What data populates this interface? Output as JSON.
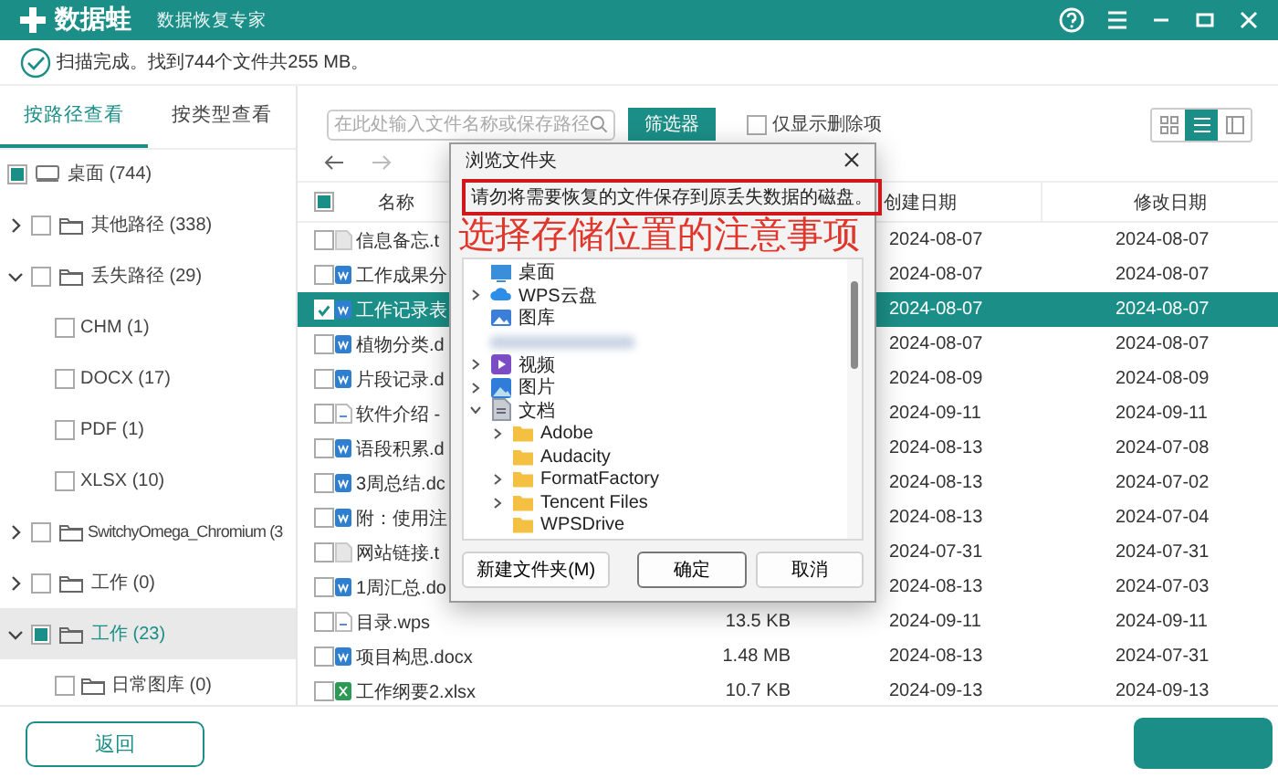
{
  "window": {
    "logo": "数据蛙",
    "subtitle": "数据恢复专家"
  },
  "status": {
    "text": "扫描完成。找到744个文件共255 MB。"
  },
  "sidebar": {
    "tabs": [
      {
        "label": "按路径查看",
        "selected": true
      },
      {
        "label": "按类型查看",
        "selected": false
      }
    ],
    "tree": [
      {
        "label": "桌面 (744)",
        "kind": "drive",
        "checked": false,
        "partial": true,
        "selected": false
      },
      {
        "label": "其他路径 (338)",
        "kind": "folder",
        "checked": false,
        "partial": false,
        "expanded": false,
        "selected": false
      },
      {
        "label": "丢失路径 (29)",
        "kind": "folder",
        "checked": false,
        "partial": false,
        "expanded": true,
        "selected": false,
        "children": [
          {
            "label": "CHM (1)",
            "kind": "type",
            "checked": false,
            "partial": false,
            "selected": false
          },
          {
            "label": "DOCX (17)",
            "kind": "type",
            "checked": false,
            "partial": false,
            "selected": false
          },
          {
            "label": "PDF (1)",
            "kind": "type",
            "checked": false,
            "partial": false,
            "selected": false
          },
          {
            "label": "XLSX (10)",
            "kind": "type",
            "checked": false,
            "partial": false,
            "selected": false
          }
        ]
      },
      {
        "label": "SwitchyOmega_Chromium (3",
        "kind": "folder",
        "checked": false,
        "partial": false,
        "expanded": false,
        "selected": false
      },
      {
        "label": "工作 (0)",
        "kind": "folder",
        "checked": false,
        "partial": false,
        "expanded": false,
        "selected": false
      },
      {
        "label": "工作 (23)",
        "kind": "folder",
        "checked": false,
        "partial": true,
        "expanded": true,
        "selected": true,
        "children": [
          {
            "label": "日常图库 (0)",
            "kind": "folder",
            "checked": false,
            "partial": false,
            "selected": false
          }
        ]
      }
    ]
  },
  "toolbar": {
    "search": {
      "placeholder": "在此处输入文件名称或保存路径"
    },
    "filter_button": "筛选器",
    "deleted_only": {
      "label": "仅显示删除项",
      "checked": false
    },
    "view_modes": [
      {
        "kind": "grid",
        "selected": false
      },
      {
        "kind": "list",
        "selected": true
      },
      {
        "kind": "panel",
        "selected": false
      }
    ]
  },
  "table": {
    "header_checkbox": {
      "checked": false,
      "partial": true
    },
    "columns": {
      "name": "名称",
      "created": "创建日期",
      "modified": "修改日期"
    },
    "rows": [
      {
        "name": "信息备忘.t",
        "kind": "txt",
        "created": "2024-08-07",
        "modified": "2024-08-07",
        "checked": false,
        "selected": false
      },
      {
        "name": "工作成果分",
        "kind": "doc",
        "created": "2024-08-07",
        "modified": "2024-08-07",
        "checked": false,
        "selected": false
      },
      {
        "name": "工作记录表",
        "kind": "doc",
        "created": "2024-08-07",
        "modified": "2024-08-07",
        "checked": true,
        "selected": true
      },
      {
        "name": "植物分类.d",
        "kind": "doc",
        "created": "2024-08-07",
        "modified": "2024-08-07",
        "checked": false,
        "selected": false
      },
      {
        "name": "片段记录.d",
        "kind": "doc",
        "created": "2024-08-09",
        "modified": "2024-08-09",
        "checked": false,
        "selected": false
      },
      {
        "name": "软件介绍 -",
        "kind": "wps",
        "created": "2024-09-11",
        "modified": "2024-09-11",
        "checked": false,
        "selected": false
      },
      {
        "name": "语段积累.d",
        "kind": "doc",
        "created": "2024-08-13",
        "modified": "2024-07-08",
        "checked": false,
        "selected": false
      },
      {
        "name": "3周总结.dc",
        "kind": "doc",
        "created": "2024-08-13",
        "modified": "2024-07-02",
        "checked": false,
        "selected": false
      },
      {
        "name": "附：使用注",
        "kind": "doc",
        "created": "2024-08-13",
        "modified": "2024-07-04",
        "checked": false,
        "selected": false
      },
      {
        "name": "网站链接.t",
        "kind": "txt",
        "created": "2024-07-31",
        "modified": "2024-07-31",
        "checked": false,
        "selected": false
      },
      {
        "name": "1周汇总.do",
        "kind": "doc",
        "created": "2024-08-13",
        "modified": "2024-07-03",
        "checked": false,
        "selected": false
      },
      {
        "name": "目录.wps",
        "kind": "wps",
        "size": "13.5 KB",
        "created": "2024-09-11",
        "modified": "2024-09-11",
        "checked": false,
        "selected": false
      },
      {
        "name": "项目构思.docx",
        "kind": "doc",
        "size": "1.48 MB",
        "created": "2024-08-13",
        "modified": "2024-07-31",
        "checked": false,
        "selected": false
      },
      {
        "name": "工作纲要2.xlsx",
        "kind": "xlsx",
        "size": "10.7 KB",
        "created": "2024-09-13",
        "modified": "2024-09-13",
        "checked": false,
        "selected": false
      }
    ]
  },
  "dialog": {
    "title": "浏览文件夹",
    "message": {
      "text": "请勿将需要恢复的文件保存到原丢失数据的磁盘。",
      "highlighted": true
    },
    "annotation": "选择存储位置的注意事项",
    "tree": [
      {
        "label": "桌面",
        "kind": "desktop"
      },
      {
        "label": "WPS云盘",
        "kind": "cloud",
        "expanded": false
      },
      {
        "label": "图库",
        "kind": "gallery"
      },
      {
        "kind": "redacted"
      },
      {
        "label": "视频",
        "kind": "video",
        "expanded": false
      },
      {
        "label": "图片",
        "kind": "pictures",
        "expanded": false
      },
      {
        "label": "文档",
        "kind": "documents",
        "expanded": true,
        "children": [
          {
            "label": "Adobe",
            "kind": "folder",
            "expanded": false
          },
          {
            "label": "Audacity",
            "kind": "folder"
          },
          {
            "label": "FormatFactory",
            "kind": "folder",
            "expanded": false
          },
          {
            "label": "Tencent Files",
            "kind": "folder",
            "expanded": false
          },
          {
            "label": "WPSDrive",
            "kind": "folder"
          }
        ]
      }
    ],
    "buttons": [
      {
        "label": "新建文件夹(M)",
        "default": false
      },
      {
        "label": "确定",
        "default": true
      },
      {
        "label": "取消",
        "default": false
      }
    ]
  },
  "footer": {
    "back_button": "返回",
    "action_button": {
      "visible": true
    }
  }
}
